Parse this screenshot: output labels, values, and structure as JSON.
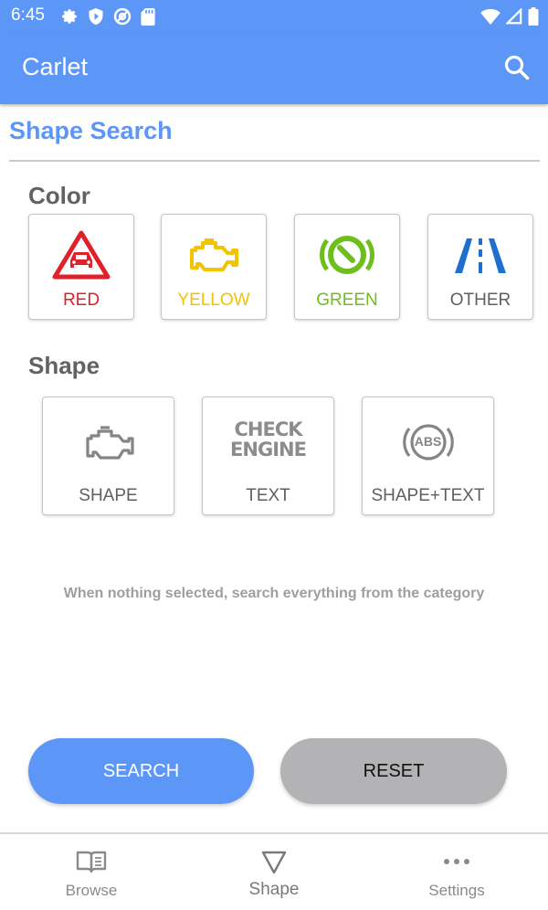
{
  "status_bar": {
    "time": "6:45",
    "left_icons": [
      "gear-icon",
      "shield-icon",
      "at-sign-icon",
      "sd-card-icon"
    ],
    "right_icons": [
      "wifi-icon",
      "signal-icon",
      "battery-icon"
    ]
  },
  "app_bar": {
    "title": "Carlet",
    "search_icon": "search-icon"
  },
  "page": {
    "title": "Shape Search"
  },
  "color_section": {
    "label": "Color",
    "options": [
      {
        "label": "RED",
        "color": "#e0202a",
        "icon": "warning-car-icon"
      },
      {
        "label": "YELLOW",
        "color": "#f2c400",
        "icon": "engine-icon"
      },
      {
        "label": "GREEN",
        "color": "#6ebe1e",
        "icon": "gauge-icon"
      },
      {
        "label": "OTHER",
        "color": "#5f5f5f",
        "icon": "lane-icon"
      }
    ]
  },
  "shape_section": {
    "label": "Shape",
    "options": [
      {
        "label": "SHAPE",
        "icon": "engine-outline-icon"
      },
      {
        "label": "TEXT",
        "icon": "check-engine-text-icon",
        "icon_text": [
          "CHECK",
          "ENGINE"
        ]
      },
      {
        "label": "SHAPE+TEXT",
        "icon": "abs-icon",
        "icon_text": [
          "ABS"
        ]
      }
    ]
  },
  "hint": "When nothing selected, search everything from the category",
  "buttons": {
    "search": "SEARCH",
    "reset": "RESET"
  },
  "bottom_nav": {
    "items": [
      {
        "label": "Browse",
        "icon": "book-icon",
        "active": false
      },
      {
        "label": "Shape",
        "icon": "triangle-icon",
        "active": true
      },
      {
        "label": "Settings",
        "icon": "more-dots-icon",
        "active": false
      }
    ]
  },
  "colors": {
    "primary": "#5c97f8",
    "reset_button": "#b3b2b4",
    "blue_icon": "#1e6fd0"
  }
}
